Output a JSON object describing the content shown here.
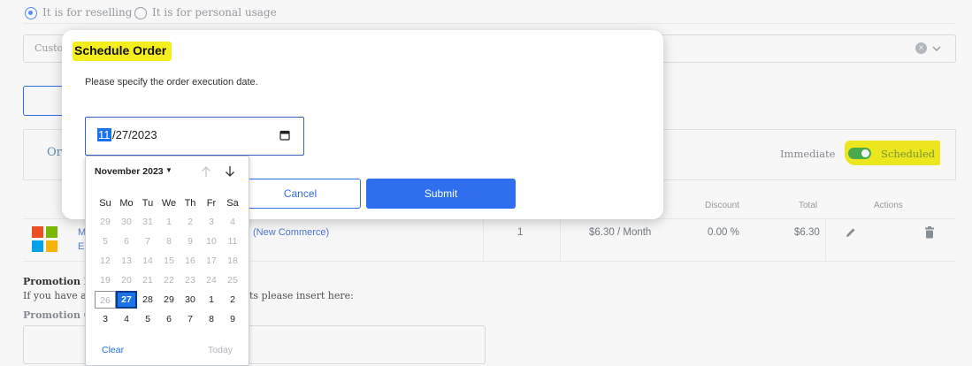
{
  "usage": {
    "option_resell": "It is for reselling",
    "option_personal": "It is for personal usage"
  },
  "customer_select": {
    "text": "Custo"
  },
  "order_panel": {
    "title_partial": "Or",
    "immediate_label": "Immediate",
    "scheduled_label": "Scheduled"
  },
  "table": {
    "headers": {
      "discount": "Discount",
      "total": "Total",
      "actions": "Actions"
    },
    "row": {
      "name_partial_1": "M",
      "name_partial_2": "E",
      "product_suffix": "(New Commerce)",
      "quantity": "1",
      "price": "$6.30 / Month",
      "discount": "0.00 %",
      "total": "$6.30"
    }
  },
  "promotion": {
    "heading_partial": "Promotion In",
    "hint_partial_left": "If you have an",
    "hint_partial_right": "ts please insert here:",
    "code_label_partial": "Promotion Co"
  },
  "modal": {
    "title": "Schedule Order",
    "description": "Please specify the order execution date.",
    "date_month": "11",
    "date_rest": "/27/2023",
    "cancel_label": "Cancel",
    "submit_label": "Submit"
  },
  "calendar": {
    "month_label": "November 2023",
    "weekdays": [
      "Su",
      "Mo",
      "Tu",
      "We",
      "Th",
      "Fr",
      "Sa"
    ],
    "weeks": [
      [
        "29",
        "30",
        "31",
        "1",
        "2",
        "3",
        "4"
      ],
      [
        "5",
        "6",
        "7",
        "8",
        "9",
        "10",
        "11"
      ],
      [
        "12",
        "13",
        "14",
        "15",
        "16",
        "17",
        "18"
      ],
      [
        "19",
        "20",
        "21",
        "22",
        "23",
        "24",
        "25"
      ],
      [
        "26",
        "27",
        "28",
        "29",
        "30",
        "1",
        "2"
      ],
      [
        "3",
        "4",
        "5",
        "6",
        "7",
        "8",
        "9"
      ]
    ],
    "clear_label": "Clear",
    "today_label": "Today"
  },
  "colors": {
    "primary": "#2f6fed",
    "highlight": "#f4ee1f",
    "toggle_on": "#4caf50"
  }
}
